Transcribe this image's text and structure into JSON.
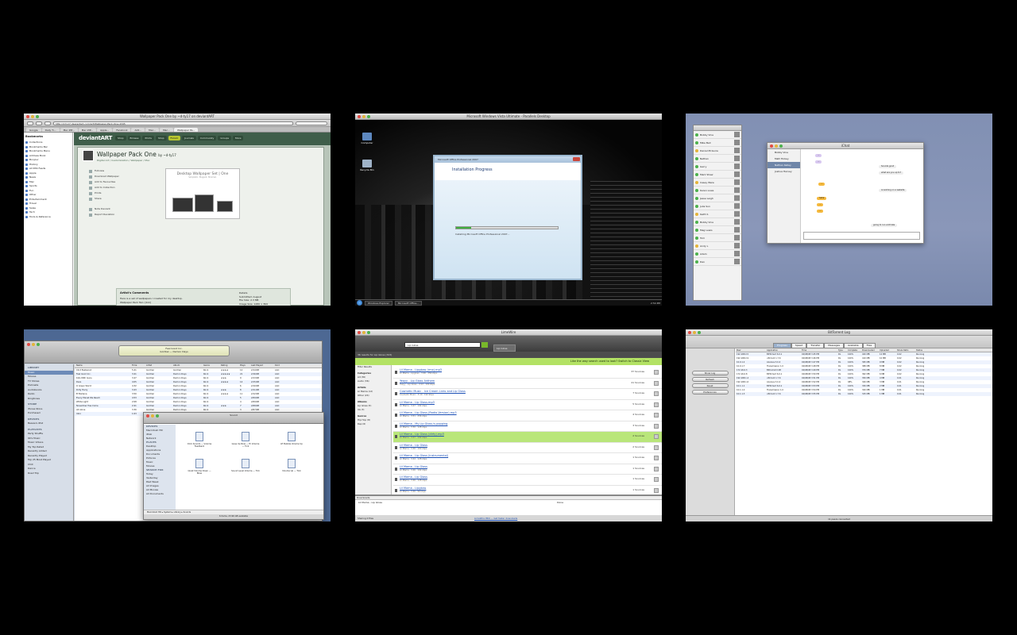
{
  "thumbs": {
    "safari": {
      "title": "Wallpaper Pack One by ~d-ty17 on deviantART",
      "url": "http://d-ty17.deviantart.com/art/Wallpaper-Pack-One-4345",
      "tabs": [
        "Google",
        "Daily Ti...",
        "Mac ZIP...",
        "Mac ZIP...",
        "Apple...",
        "Facebook",
        "Add...",
        "Mac...",
        "Mac...",
        "Wallpaper Pa..."
      ],
      "sidebar_header": "Bookmarks",
      "sidebar_items": [
        "Collections",
        "Bookmarks Bar",
        "Bookmarks Menu",
        "Address Book",
        "Bonjour",
        "History",
        "All RSS Feeds",
        "Apple",
        "News",
        "Mac",
        "Sports",
        "Fun",
        "Other",
        "Entertainment",
        "Travel",
        "Sales",
        "Tech",
        "Tools & Reference"
      ],
      "site_logo": "deviantART",
      "nav": [
        "Shop",
        "Browse",
        "Prints",
        "Shop",
        "Forum",
        "Journals",
        "Community",
        "Groups",
        "More"
      ],
      "art_title": "Wallpaper Pack One",
      "art_by": "by ~d-ty17",
      "art_sub": "Digital Art / Customization / Wallpaper / Mac",
      "actions": [
        "Fullview",
        "Download Wallpaper",
        "Add to Favourites",
        "Add to Collection",
        "Prints",
        "Share"
      ],
      "actions2": [
        "Note Deviant",
        "Report Deviation"
      ],
      "preview_title": "Desktop Wallpaper Set | One",
      "preview_sub": "Simplistic. Elegant. Minimal.",
      "comments_title": "Artist's Comments",
      "comments": [
        "Here is a set of wallpapers I created for my desktop.",
        "Wallpaper Pack Two: [link]",
        "Wallpaper Pack Three: [link]",
        "Wallpaper Pack Four: [link]",
        "",
        "Please comment!",
        "Fave: [link]"
      ],
      "details": [
        "Details",
        "Submitted: August",
        "File Size: 2.3 MB",
        "Image Size: 1280 × 800",
        "Resolution: 1280×800",
        "Comments: 14",
        "Favourites: 27 [who?]",
        "",
        "Shares",
        "Downloads: 2,319"
      ]
    },
    "windows": {
      "title": "Microsoft Windows Vista Ultimate - Parallels Desktop",
      "menu": "Edit  View  Actions  Devices  Help",
      "right": "Full Screen  Coherence",
      "icons": [
        "Computer",
        "Recycle Bin"
      ],
      "installer_title": "Installation Progress",
      "installer_header": "Microsoft Office Professional 2007",
      "installer_status": "Installing Microsoft Office Professional 2007...",
      "progress": 0.15,
      "tasks": [
        "Windows Explorer",
        "Microsoft Office..."
      ],
      "tray": "2:54 PM"
    },
    "chat": {
      "buddy_title": "Adium",
      "buddies": [
        "Bobby Vine",
        "Mike Bell",
        "Daniel McGuire",
        "Nathan",
        "Gerry",
        "Mark Shaw",
        "Casey Ware",
        "Karen Lowe",
        "Jesse Leigh",
        "Julia Sun",
        "Keith S",
        "Bobby Vine",
        "Meg Lewis",
        "Tom",
        "Andy L",
        "Adam",
        "Dan"
      ],
      "chat_title": "iChat",
      "chat_people": [
        "Bobby Vine",
        "Matt Hickey",
        "Nathan Kelley",
        "Joshua Harvey"
      ],
      "messages": [
        "...",
        "...",
        "Sounds good",
        "what are you up to?",
        "...",
        "is working on a website",
        "haha",
        "...",
        "...",
        "going to run a bit late"
      ]
    },
    "itunes": {
      "title": "iTunes",
      "now_playing": "Feel Good Inc.",
      "now_artist": "Gorillaz — Demon Days",
      "source_headers": [
        "LIBRARY",
        "STORE",
        "DEVICES",
        "PLAYLISTS"
      ],
      "library_items": [
        "Music",
        "Movies",
        "TV Shows",
        "Podcasts",
        "Audiobooks",
        "Radio",
        "Ringtones"
      ],
      "store_items": [
        "iTunes Store",
        "Purchased"
      ],
      "device_items": [
        "Bessie's iPod"
      ],
      "playlist_items": [
        "Party Shuffle",
        "90's Music",
        "Music Videos",
        "My Top Rated",
        "Recently Added",
        "Recently Played",
        "Top 25 Most Played",
        "Chill",
        "Dance",
        "Road Trip"
      ],
      "columns": [
        "Name",
        "Time",
        "Artist",
        "Album",
        "Genre",
        "Rating",
        "Plays",
        "Last Played",
        "Kind"
      ],
      "rows": [
        [
          "Clint Eastwood",
          "5:41",
          "Gorillaz",
          "Gorillaz",
          "Rock",
          "★★★★",
          "12",
          "2/14/08",
          "AAC"
        ],
        [
          "Feel Good Inc.",
          "3:41",
          "Gorillaz",
          "Demon Days",
          "Rock",
          "★★★★★",
          "21",
          "2/16/08",
          "AAC"
        ],
        [
          "Kids With Guns",
          "3:47",
          "Gorillaz",
          "Demon Days",
          "Rock",
          "★★★",
          "9",
          "2/13/08",
          "AAC"
        ],
        [
          "Dare",
          "4:05",
          "Gorillaz",
          "Demon Days",
          "Rock",
          "★★★★",
          "14",
          "2/15/08",
          "AAC"
        ],
        [
          "O Green World",
          "4:32",
          "Gorillaz",
          "Demon Days",
          "Rock",
          "",
          "6",
          "2/10/08",
          "AAC"
        ],
        [
          "Dirty Harry",
          "3:43",
          "Gorillaz",
          "Demon Days",
          "Rock",
          "★★★",
          "8",
          "2/11/08",
          "AAC"
        ],
        [
          "El Mañana",
          "3:50",
          "Gorillaz",
          "Demon Days",
          "Rock",
          "★★★★",
          "11",
          "2/12/08",
          "AAC"
        ],
        [
          "Every Planet We Reach",
          "4:53",
          "Gorillaz",
          "Demon Days",
          "Rock",
          "",
          "5",
          "2/09/08",
          "AAC"
        ],
        [
          "White Light",
          "2:08",
          "Gorillaz",
          "Demon Days",
          "Rock",
          "",
          "4",
          "2/09/08",
          "AAC"
        ],
        [
          "November Has Come",
          "2:41",
          "Gorillaz",
          "Demon Days",
          "Rock",
          "★★★",
          "7",
          "2/08/08",
          "AAC"
        ],
        [
          "All Alone",
          "3:30",
          "Gorillaz",
          "Demon Days",
          "Rock",
          "",
          "3",
          "2/07/08",
          "AAC"
        ],
        [
          "Intro",
          "1:03",
          "Gorillaz",
          "Demon Days",
          "Rock",
          "",
          "2",
          "2/07/08",
          "AAC"
        ]
      ],
      "finder_title": "Sound",
      "finder_side_headers": [
        "DEVICES",
        "PLACES",
        "SEARCH FOR"
      ],
      "finder_devices": [
        "Macintosh HD",
        "iDisk",
        "Network"
      ],
      "finder_places": [
        "Desktop",
        "Applications",
        "Documents",
        "Pictures",
        "Music",
        "Movies"
      ],
      "finder_search": [
        "Today",
        "Yesterday",
        "Past Week",
        "All Images",
        "All Movies",
        "All Documents"
      ],
      "finder_files": [
        "Click Sounds — Volume Feedback",
        "Goes Up Now — Hi Volume — Tick",
        "LE Bubble Volume Up",
        "Quiet Volume Down — Blow",
        "Sound Level Volume — Tick",
        "Volume Up — Tink"
      ],
      "finder_path": "Macintosh HD ▸ System ▸ Library ▸ Sounds",
      "finder_status": "6 items, 23.96 GB available"
    },
    "limewire": {
      "title": "LimeWire",
      "search_value": "Lip Gloss",
      "tab_label": "Lip Gloss",
      "results_count": "36 results for Lip Gloss (323)",
      "banner": "Like the way search used to look? Switch to Classic View",
      "side_items": [
        "Filter Results",
        "",
        "Categories",
        "All (36)",
        "Audio (36)",
        "",
        "Artists",
        "Lil Mama (12)",
        "Other (24)",
        "",
        "Albums",
        "Lip Gloss (5)",
        "VA (3)",
        "",
        "Genres",
        "Hip Hop (8)",
        "Rap (6)"
      ],
      "results": [
        {
          "name": "Lil Mama - Lipgloss (rmx).mp3",
          "sub": "Lil Mama · Lipgloss · 3:46 · 256 kbps",
          "count": "37"
        },
        {
          "name": "Yeayy - Lip Gloss Anthem",
          "sub": "Yeayy · Lip Gloss · 4:12 · 192 kbps",
          "count": "21"
        },
        {
          "name": "Cosmetic Music - Ice Cream Licks and Lip Gloss",
          "sub": "Cosmetic Music · 3:10 · 192 kbps",
          "count": "7"
        },
        {
          "name": "Lil Mama - Lip Gloss.mp3",
          "sub": "Lil Mama · 3:47 · 192 kbps",
          "count": "5"
        },
        {
          "name": "Lil Mama - Lip Gloss (Radio Version).mp3",
          "sub": "Lil Mama · 3:51 · 256 kbps",
          "count": "4"
        },
        {
          "name": "Lil Mama - My Lip Gloss is popping",
          "sub": "Lil Mama · 3:30 · 128 kbps",
          "count": "3"
        },
        {
          "name": "Lil Mama - Lip Gloss (dirty).mp3",
          "sub": "Lil Mama · 3:47 · 192 kbps",
          "count": "2"
        },
        {
          "name": "Lil Mama - Lip Gloss",
          "sub": "Lil Mama · 3:46 · 160 kbps",
          "count": "2"
        },
        {
          "name": "Lil Mama - Lip Gloss (instrumental)",
          "sub": "Lil Mama · 3:44 · 128 kbps",
          "count": "1"
        },
        {
          "name": "Lil Mama - Lip Gloss",
          "sub": "Lil Mama · 3:46 · 192 kbps",
          "count": "1"
        },
        {
          "name": "Lil Mama - Lip Gloss",
          "sub": "Lil Mama · 3:46 · 128 kbps",
          "count": "1"
        },
        {
          "name": "Lil Mama - Lipgloss",
          "sub": "Lil Mama · 3:46 · 96 kbps",
          "count": "1"
        }
      ],
      "result_unit": "Sources",
      "downloads_header": "Downloads",
      "download_item": "Lil Mama - Lip Gloss",
      "download_state": "Done",
      "status_left": "Sharing 0 files",
      "status_link": "LimeWire PRO — Get faster downloads"
    },
    "transmission": {
      "title": "BitTorrent Log",
      "seg": [
        "Progress",
        "Speed",
        "Transfer",
        "Messages",
        "Available",
        "Files"
      ],
      "side_buttons": [
        "Show Log",
        "Refresh",
        "Reset",
        "Preferences"
      ],
      "columns": [
        "Peer",
        "Application",
        "Time",
        "Type",
        "Complete",
        "Downloaded",
        "Uploaded",
        "Share Ratio",
        "Status"
      ],
      "rows": [
        [
          "192.168.0.5",
          "BitTorrent 6.0.1",
          "02/08/08 3:45 PM",
          "DL",
          "100%",
          "420 MB",
          "12 MB",
          "0.02",
          "Running"
        ],
        [
          "192.168.0.9",
          "uTorrent 1.7.6",
          "02/08/08 3:46 PM",
          "DL",
          "100%",
          "410 MB",
          "10 MB",
          "0.02",
          "Running"
        ],
        [
          "10.0.1.2",
          "Azureus 3.0.4",
          "02/08/08 3:47 PM",
          "DL",
          "100%",
          "395 MB",
          "9 MB",
          "0.02",
          "Running"
        ],
        [
          "10.0.1.7",
          "Transmission 1.0",
          "02/08/08 3:48 PM",
          "DL",
          "100%",
          "388 MB",
          "8 MB",
          "0.02",
          "Running"
        ],
        [
          "172.16.0.3",
          "BitComet 0.98",
          "02/08/08 3:49 PM",
          "DL",
          "100%",
          "370 MB",
          "7 MB",
          "0.02",
          "Running"
        ],
        [
          "172.16.0.8",
          "BitTorrent 6.0.1",
          "02/08/08 3:50 PM",
          "DL",
          "100%",
          "362 MB",
          "6 MB",
          "0.02",
          "Running"
        ],
        [
          "192.168.1.4",
          "uTorrent 1.7.6",
          "02/08/08 3:51 PM",
          "DL",
          "100%",
          "350 MB",
          "4 MB",
          "0.01",
          "Running"
        ],
        [
          "192.168.1.6",
          "Azureus 3.0.4",
          "02/08/08 3:52 PM",
          "DL",
          "98%",
          "340 MB",
          "3 MB",
          "0.01",
          "Running"
        ],
        [
          "10.1.1.1",
          "BitTorrent 6.0.1",
          "02/08/08 3:53 PM",
          "DL",
          "100%",
          "330 MB",
          "2 MB",
          "0.01",
          "Running"
        ],
        [
          "10.1.1.2",
          "Transmission 1.0",
          "02/08/08 3:54 PM",
          "DL",
          "100%",
          "320 MB",
          "1 MB",
          "0.01",
          "Running"
        ],
        [
          "10.1.1.3",
          "uTorrent 1.7.6",
          "02/08/08 3:55 PM",
          "DL",
          "100%",
          "315 MB",
          "1 MB",
          "0.01",
          "Running"
        ]
      ],
      "status": "11 peers connected"
    }
  }
}
